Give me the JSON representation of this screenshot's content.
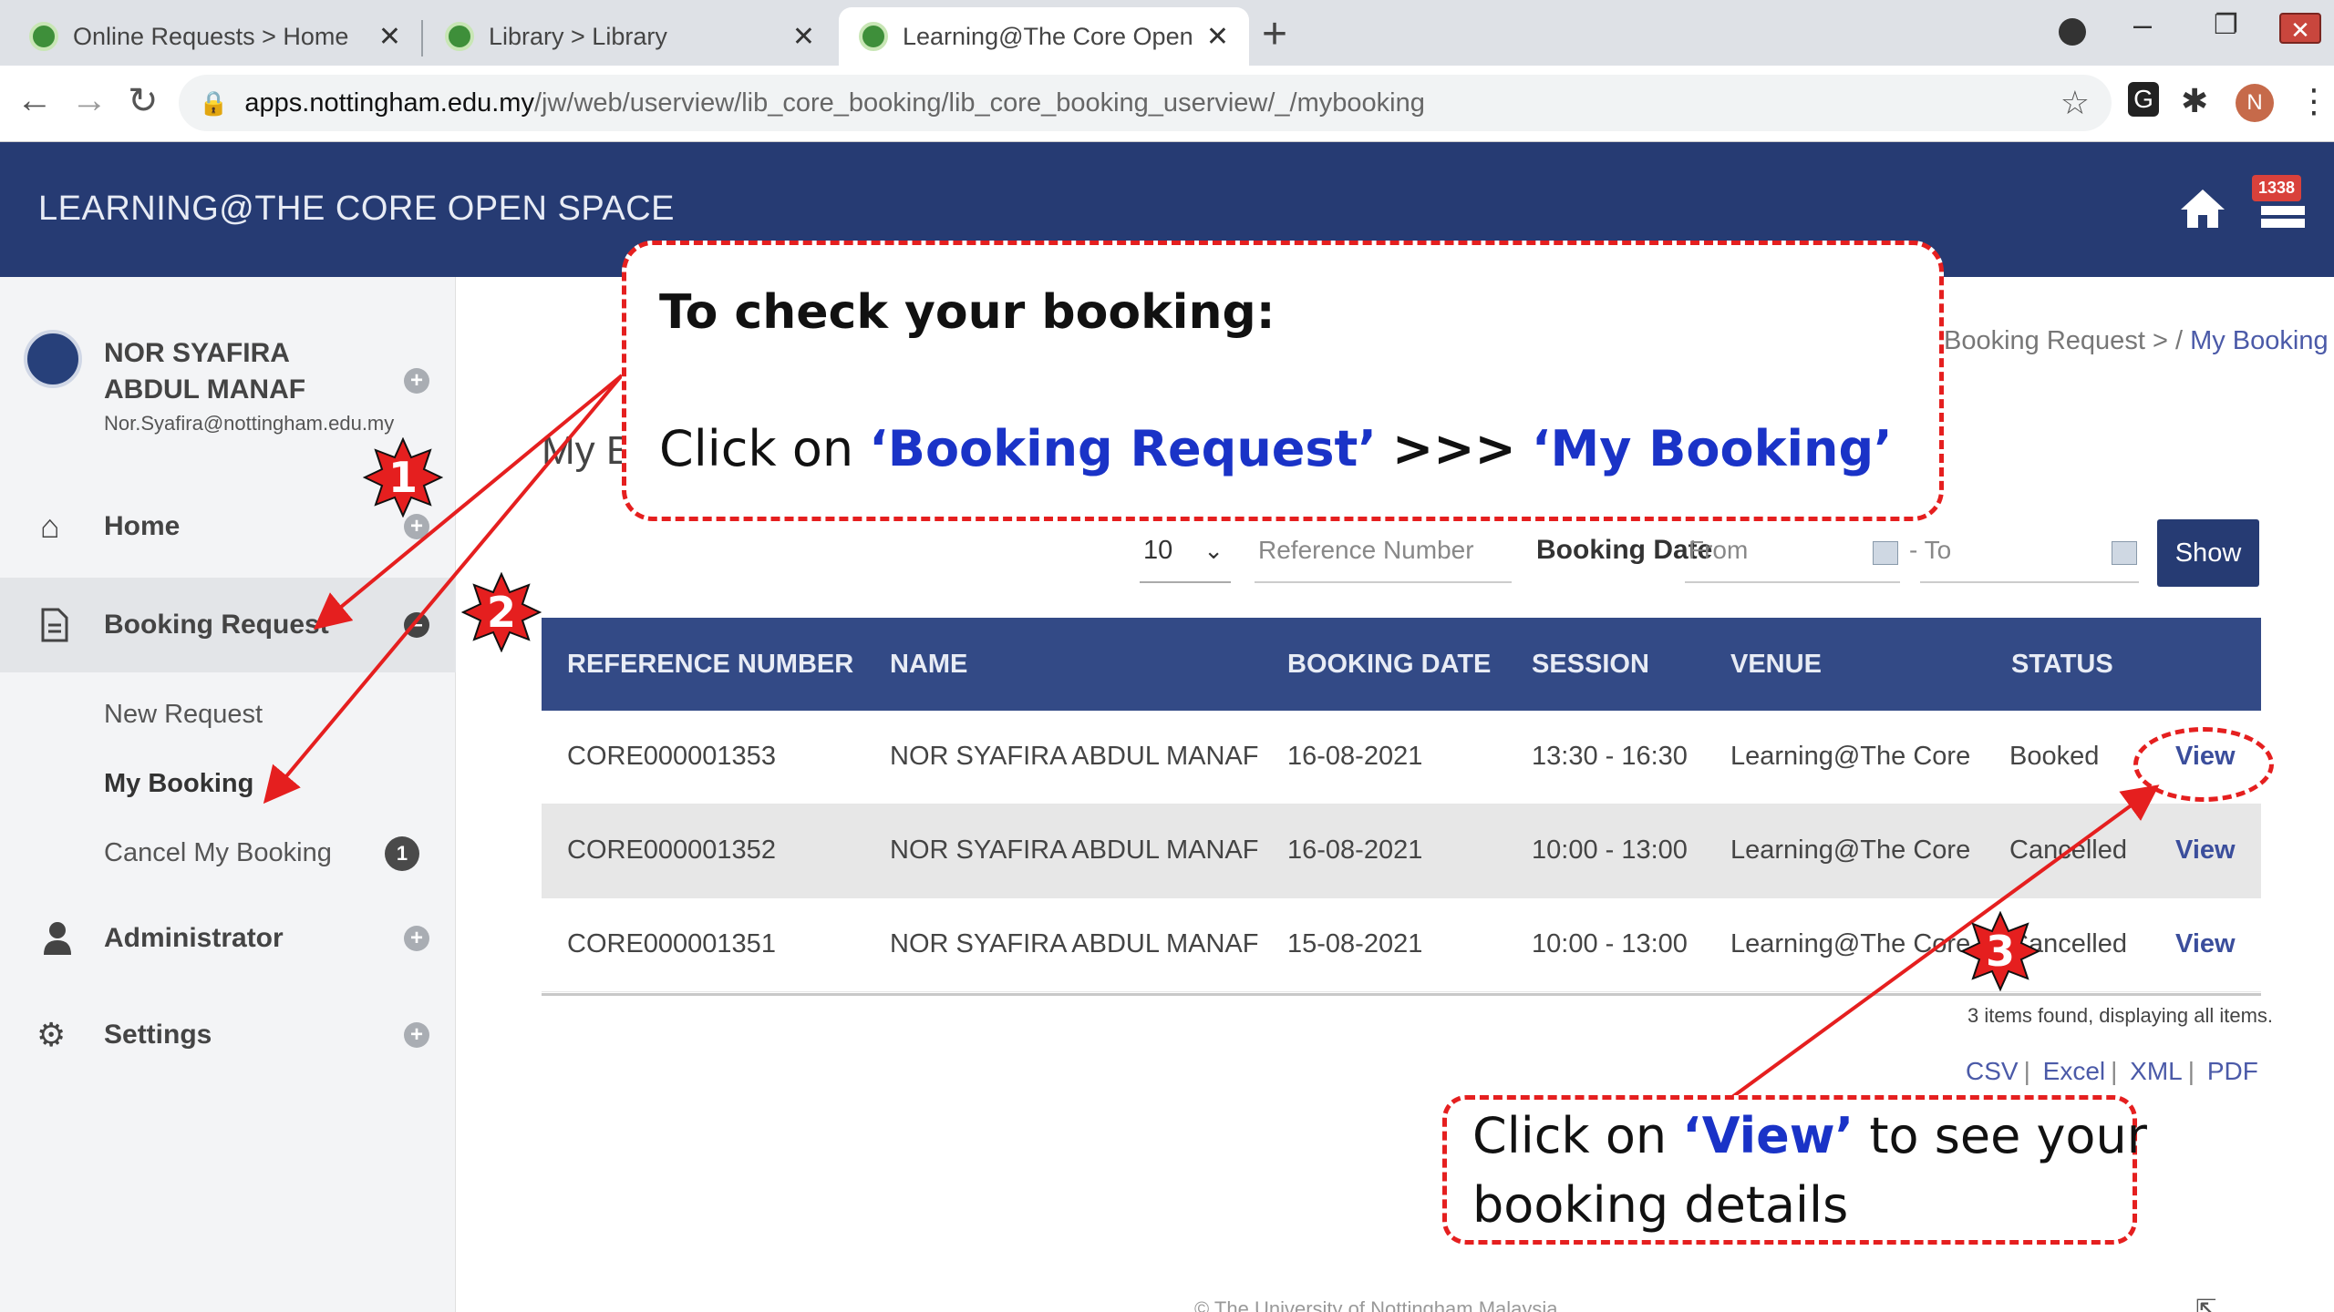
{
  "browser": {
    "tabs": [
      {
        "title": "Online Requests > Home"
      },
      {
        "title": "Library > Library"
      },
      {
        "title": "Learning@The Core Open Space"
      }
    ],
    "url_domain": "apps.nottingham.edu.my",
    "url_path": "/jw/web/userview/lib_core_booking/lib_core_booking_userview/_/mybooking",
    "profile_initial": "N"
  },
  "header": {
    "title": "LEARNING@THE CORE OPEN SPACE",
    "notification_count": "1338"
  },
  "sidebar": {
    "user_name": "NOR SYAFIRA ABDUL MANAF",
    "user_email": "Nor.Syafira@nottingham.edu.my",
    "items": [
      {
        "label": "Home",
        "icon": "home-icon"
      },
      {
        "label": "Booking Request",
        "icon": "document-icon"
      },
      {
        "label": "Administrator",
        "icon": "user-icon"
      },
      {
        "label": "Settings",
        "icon": "gears-icon"
      }
    ],
    "subitems": [
      {
        "label": "New Request"
      },
      {
        "label": "My Booking"
      },
      {
        "label": "Cancel My Booking",
        "badge": "1"
      }
    ]
  },
  "main": {
    "breadcrumb_parent": "Booking Request",
    "breadcrumb_sep": ">",
    "breadcrumb_slash": "/",
    "breadcrumb_current": "My Booking",
    "page_title": "My B",
    "filters": {
      "page_size": "10",
      "reference_placeholder": "Reference Number",
      "booking_date_label": "Booking Date",
      "from_placeholder": "From",
      "to_label": "- To",
      "show_label": "Show"
    },
    "columns": [
      "REFERENCE NUMBER",
      "NAME",
      "BOOKING DATE",
      "SESSION",
      "VENUE",
      "STATUS"
    ],
    "rows": [
      {
        "ref": "CORE000001353",
        "name": "NOR SYAFIRA ABDUL MANAF",
        "date": "16-08-2021",
        "session": "13:30 - 16:30",
        "venue": "Learning@The Core",
        "status": "Booked",
        "action": "View"
      },
      {
        "ref": "CORE000001352",
        "name": "NOR SYAFIRA ABDUL MANAF",
        "date": "16-08-2021",
        "session": "10:00 - 13:00",
        "venue": "Learning@The Core",
        "status": "Cancelled",
        "action": "View"
      },
      {
        "ref": "CORE000001351",
        "name": "NOR SYAFIRA ABDUL MANAF",
        "date": "15-08-2021",
        "session": "10:00 - 13:00",
        "venue": "Learning@The Core",
        "status": "Cancelled",
        "action": "View"
      }
    ],
    "items_found": "3 items found, displaying all items.",
    "exports": [
      "CSV",
      "Excel",
      "XML",
      "PDF"
    ],
    "footer": "© The University of Nottingham Malaysia"
  },
  "tutorial": {
    "callout_top_heading": "To check your booking:",
    "callout_top_prefix": "Click on",
    "callout_top_em1": "‘Booking Request’",
    "callout_top_mid": ">>>",
    "callout_top_em2": "‘My Booking’",
    "callout_bottom_prefix": "Click on",
    "callout_bottom_em": "‘View’",
    "callout_bottom_suffix": "to see your",
    "callout_bottom_line2": "booking details",
    "step_labels": [
      "1",
      "2",
      "3"
    ],
    "accent_color": "#e51f1f",
    "emphasis_color": "#1a33c7"
  },
  "colors": {
    "header_bg": "#263b73",
    "table_header_bg": "#334a86",
    "sidebar_bg": "#f3f4f6"
  }
}
